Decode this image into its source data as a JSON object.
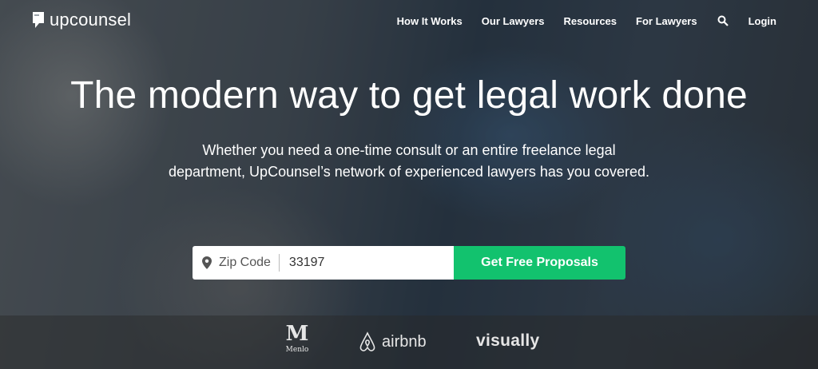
{
  "brand": {
    "name": "upcounsel"
  },
  "nav": {
    "items": [
      {
        "label": "How It Works"
      },
      {
        "label": "Our Lawyers"
      },
      {
        "label": "Resources"
      },
      {
        "label": "For Lawyers"
      }
    ],
    "search_icon": "search-icon",
    "login": "Login"
  },
  "hero": {
    "headline": "The modern way to get legal work done",
    "subhead_line1": "Whether you need a one-time consult or an entire freelance legal",
    "subhead_line2": "department, UpCounsel’s network of experienced lawyers has you covered."
  },
  "search": {
    "zip_label": "Zip Code",
    "zip_value": "33197",
    "button_label": "Get Free Proposals",
    "button_color": "#12c26e"
  },
  "partners": {
    "menlo": {
      "letter": "M",
      "text": "Menlo"
    },
    "airbnb": "airbnb",
    "visually": "visually"
  }
}
